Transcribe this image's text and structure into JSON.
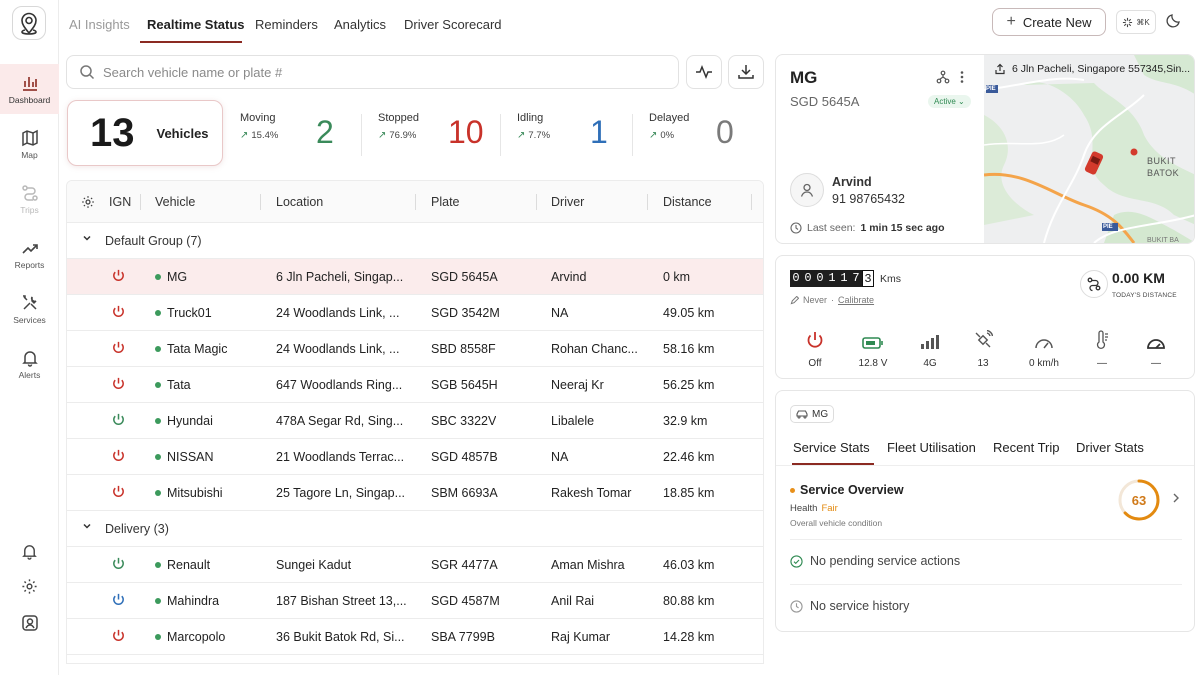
{
  "sidebar": {
    "items": [
      {
        "label": "Dashboard",
        "icon": "bar-chart-icon"
      },
      {
        "label": "Map",
        "icon": "map-icon"
      },
      {
        "label": "Trips",
        "icon": "route-icon"
      },
      {
        "label": "Reports",
        "icon": "trend-icon"
      },
      {
        "label": "Services",
        "icon": "tools-icon"
      },
      {
        "label": "Alerts",
        "icon": "bell-icon"
      }
    ]
  },
  "topnav": {
    "tabs": [
      "AI Insights",
      "Realtime Status",
      "Reminders",
      "Analytics",
      "Driver Scorecard"
    ],
    "create_label": "Create New",
    "shortcut_label": "⌘K"
  },
  "search": {
    "placeholder": "Search vehicle name or plate #"
  },
  "stats": {
    "total": {
      "value": "13",
      "label": "Vehicles"
    },
    "items": [
      {
        "label": "Moving",
        "pct": "15.4%",
        "value": "2",
        "color": "#3a8a5a"
      },
      {
        "label": "Stopped",
        "pct": "76.9%",
        "value": "10",
        "color": "#c8322a"
      },
      {
        "label": "Idling",
        "pct": "7.7%",
        "value": "1",
        "color": "#2f6fb8"
      },
      {
        "label": "Delayed",
        "pct": "0%",
        "value": "0",
        "color": "#7a7a7a"
      }
    ]
  },
  "table": {
    "columns": [
      "IGN",
      "Vehicle",
      "Location",
      "Plate",
      "Driver",
      "Distance"
    ],
    "groups": [
      {
        "label": "Default Group (7)"
      },
      {
        "label": "Delivery (3)"
      }
    ],
    "rows": [
      {
        "ign": "red",
        "vehicle": "MG",
        "location": "6 Jln Pacheli, Singap...",
        "plate": "SGD 5645A",
        "driver": "Arvind",
        "distance": "0 km"
      },
      {
        "ign": "red",
        "vehicle": "Truck01",
        "location": "24 Woodlands Link, ...",
        "plate": "SGD 3542M",
        "driver": "NA",
        "distance": "49.05 km"
      },
      {
        "ign": "red",
        "vehicle": "Tata Magic",
        "location": "24 Woodlands Link, ...",
        "plate": "SBD 8558F",
        "driver": "Rohan Chanc...",
        "distance": "58.16 km"
      },
      {
        "ign": "red",
        "vehicle": "Tata",
        "location": "647 Woodlands Ring...",
        "plate": "SGB 5645H",
        "driver": "Neeraj Kr",
        "distance": "56.25 km"
      },
      {
        "ign": "green",
        "vehicle": "Hyundai",
        "location": "478A Segar Rd, Sing...",
        "plate": "SBC 3322V",
        "driver": "Libalele",
        "distance": "32.9 km"
      },
      {
        "ign": "red",
        "vehicle": "NISSAN",
        "location": "21 Woodlands Terrac...",
        "plate": "SGD 4857B",
        "driver": "NA",
        "distance": "22.46 km"
      },
      {
        "ign": "red",
        "vehicle": "Mitsubishi",
        "location": "25 Tagore Ln, Singap...",
        "plate": "SBM 6693A",
        "driver": "Rakesh Tomar",
        "distance": "18.85 km"
      },
      {
        "ign": "green",
        "vehicle": "Renault",
        "location": "Sungei Kadut",
        "plate": "SGR 4477A",
        "driver": "Aman Mishra",
        "distance": "46.03 km"
      },
      {
        "ign": "blue",
        "vehicle": "Mahindra",
        "location": "187 Bishan Street 13,...",
        "plate": "SGD 4587M",
        "driver": "Anil Rai",
        "distance": "80.88 km"
      },
      {
        "ign": "red",
        "vehicle": "Marcopolo",
        "location": "36 Bukit Batok Rd, Si...",
        "plate": "SBA 7799B",
        "driver": "Raj Kumar",
        "distance": "14.28 km"
      }
    ]
  },
  "vehicle_card": {
    "name": "MG",
    "plate": "SGD 5645A",
    "status": "Active",
    "driver_name": "Arvind",
    "driver_phone": "91 98765432",
    "last_seen_label": "Last seen:",
    "last_seen_value": "1 min 15 sec ago",
    "address": "6 Jln Pacheli, Singapore 557345,Sin...",
    "map_labels": {
      "pie1": "PIE",
      "pie2": "PIE",
      "bukit": "BUKIT",
      "batok": "BATOK",
      "bukit2": "BUKIT BA"
    }
  },
  "odometer": {
    "digits": [
      "0",
      "0",
      "0",
      "1",
      "1",
      "7",
      "3"
    ],
    "unit": "Kms",
    "never": "Never",
    "calibrate": "Calibrate",
    "today_value": "0.00 KM",
    "today_label": "TODAY'S DISTANCE",
    "sensors": [
      {
        "icon": "power-icon",
        "value": "Off"
      },
      {
        "icon": "battery-icon",
        "value": "12.8 V"
      },
      {
        "icon": "signal-icon",
        "value": "4G"
      },
      {
        "icon": "satellite-icon",
        "value": "13"
      },
      {
        "icon": "speedometer-icon",
        "value": "0 km/h"
      },
      {
        "icon": "thermometer-icon",
        "value": "—"
      },
      {
        "icon": "gauge-icon",
        "value": "—"
      }
    ]
  },
  "service_panel": {
    "chip": "MG",
    "tabs": [
      "Service Stats",
      "Fleet Utilisation",
      "Recent Trip",
      "Driver Stats"
    ],
    "overview_title": "Service Overview",
    "health_label": "Health",
    "health_value": "Fair",
    "health_desc": "Overall vehicle condition",
    "score": "63",
    "score_fraction": 0.63,
    "pending": "No pending service actions",
    "history": "No service history"
  },
  "colors": {
    "accent": "#8b2a22",
    "green": "#3a8a5a",
    "red": "#c8322a",
    "blue": "#2f6fb8",
    "orange": "#e38a10"
  }
}
